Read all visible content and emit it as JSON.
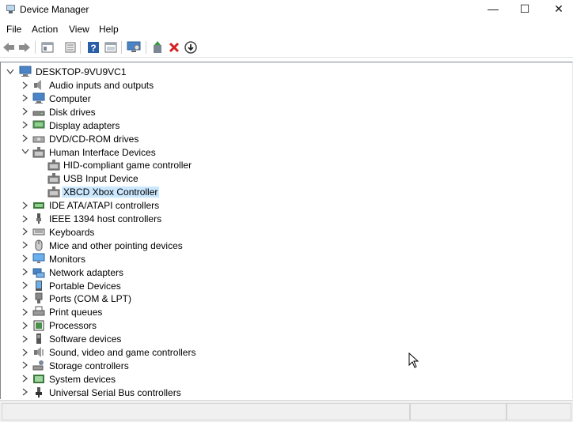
{
  "window": {
    "title": "Device Manager",
    "minimize": "—",
    "maximize": "☐",
    "close": "✕"
  },
  "menu": [
    "File",
    "Action",
    "View",
    "Help"
  ],
  "toolbar": [
    "back-icon",
    "forward-icon",
    "properties-icon",
    "update-driver-icon",
    "help-icon",
    "scan-icon",
    "monitor-icon",
    "add-driver-icon",
    "uninstall-icon",
    "disable-icon"
  ],
  "tree": {
    "root": "DESKTOP-9VU9VC1",
    "items": [
      {
        "label": "Audio inputs and outputs",
        "icon": "speaker-icon",
        "expanded": false
      },
      {
        "label": "Computer",
        "icon": "computer-icon",
        "expanded": false
      },
      {
        "label": "Disk drives",
        "icon": "disk-icon",
        "expanded": false
      },
      {
        "label": "Display adapters",
        "icon": "display-icon",
        "expanded": false
      },
      {
        "label": "DVD/CD-ROM drives",
        "icon": "dvd-icon",
        "expanded": false
      },
      {
        "label": "Human Interface Devices",
        "icon": "hid-icon",
        "expanded": true,
        "children": [
          {
            "label": "HID-compliant game controller",
            "icon": "hid-icon",
            "selected": false
          },
          {
            "label": "USB Input Device",
            "icon": "hid-icon",
            "selected": false
          },
          {
            "label": "XBCD Xbox Controller",
            "icon": "hid-icon",
            "selected": true
          }
        ]
      },
      {
        "label": "IDE ATA/ATAPI controllers",
        "icon": "ide-icon",
        "expanded": false
      },
      {
        "label": "IEEE 1394 host controllers",
        "icon": "ieee1394-icon",
        "expanded": false
      },
      {
        "label": "Keyboards",
        "icon": "keyboard-icon",
        "expanded": false
      },
      {
        "label": "Mice and other pointing devices",
        "icon": "mouse-icon",
        "expanded": false
      },
      {
        "label": "Monitors",
        "icon": "monitor-icon",
        "expanded": false
      },
      {
        "label": "Network adapters",
        "icon": "network-icon",
        "expanded": false
      },
      {
        "label": "Portable Devices",
        "icon": "portable-icon",
        "expanded": false
      },
      {
        "label": "Ports (COM & LPT)",
        "icon": "port-icon",
        "expanded": false
      },
      {
        "label": "Print queues",
        "icon": "printer-icon",
        "expanded": false
      },
      {
        "label": "Processors",
        "icon": "processor-icon",
        "expanded": false
      },
      {
        "label": "Software devices",
        "icon": "software-icon",
        "expanded": false
      },
      {
        "label": "Sound, video and game controllers",
        "icon": "sound-icon",
        "expanded": false
      },
      {
        "label": "Storage controllers",
        "icon": "storage-icon",
        "expanded": false
      },
      {
        "label": "System devices",
        "icon": "system-icon",
        "expanded": false
      },
      {
        "label": "Universal Serial Bus controllers",
        "icon": "usb-icon",
        "expanded": false
      }
    ]
  },
  "colors": {
    "selection": "#cce8ff",
    "uninstall": "#d61f1f"
  }
}
